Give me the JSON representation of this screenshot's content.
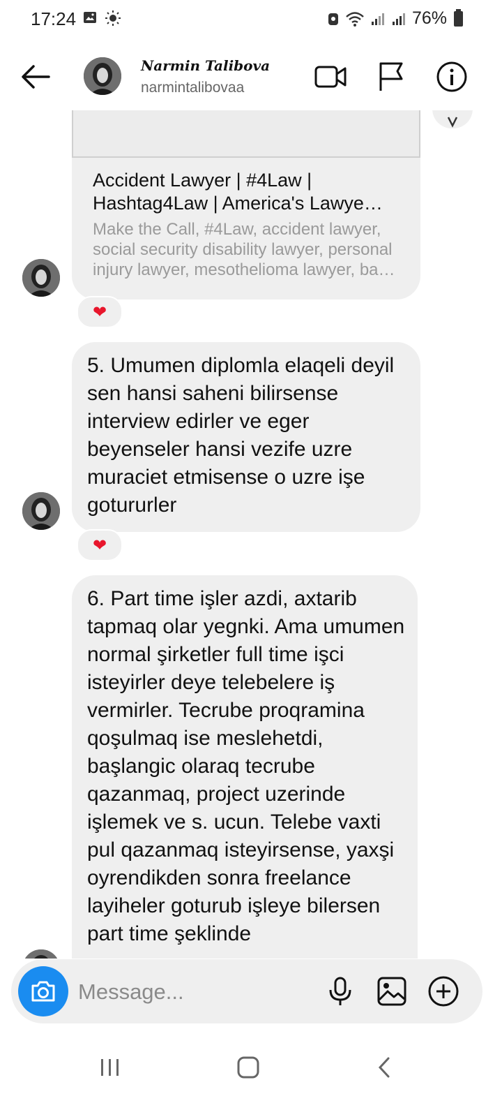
{
  "status": {
    "time": "17:24",
    "battery": "76%"
  },
  "header": {
    "name": "Narmin Talibova",
    "username": "narmintalibovaa"
  },
  "messages": {
    "link": {
      "title": "Accident Lawyer | #4Law | Hashtag4Law | America's Lawye…",
      "description": "Make the Call, #4Law, accident lawyer, social security disability lawyer, personal injury lawyer, mesothelioma lawyer, ba…",
      "reaction": "❤"
    },
    "msg5": {
      "text": "5. Umumen diplomla elaqeli deyil sen hansi saheni bilirsense interview edirler ve eger beyenseler hansi vezife uzre muraciet etmisense o uzre işe gotururler",
      "reaction": "❤"
    },
    "msg6": {
      "text": "6. Part time işler azdi, axtarib tapmaq olar yegnki. Ama umumen normal şirketler full time işci isteyirler deye telebelere iş vermirler. Tecrube proqramina qoşulmaq ise meslehetdi, başlangic olaraq tecrube qazanmaq, project uzerinde işlemek ve s. ucun. Telebe vaxti pul qazanmaq isteyirsense, yaxşi oyrendikden sonra freelance layiheler goturub işleye bilersen part time şeklinde"
    }
  },
  "composer": {
    "placeholder": "Message..."
  },
  "colors": {
    "accent": "#1a8cf0",
    "bubble": "#efefef",
    "heart": "#e8162c"
  }
}
